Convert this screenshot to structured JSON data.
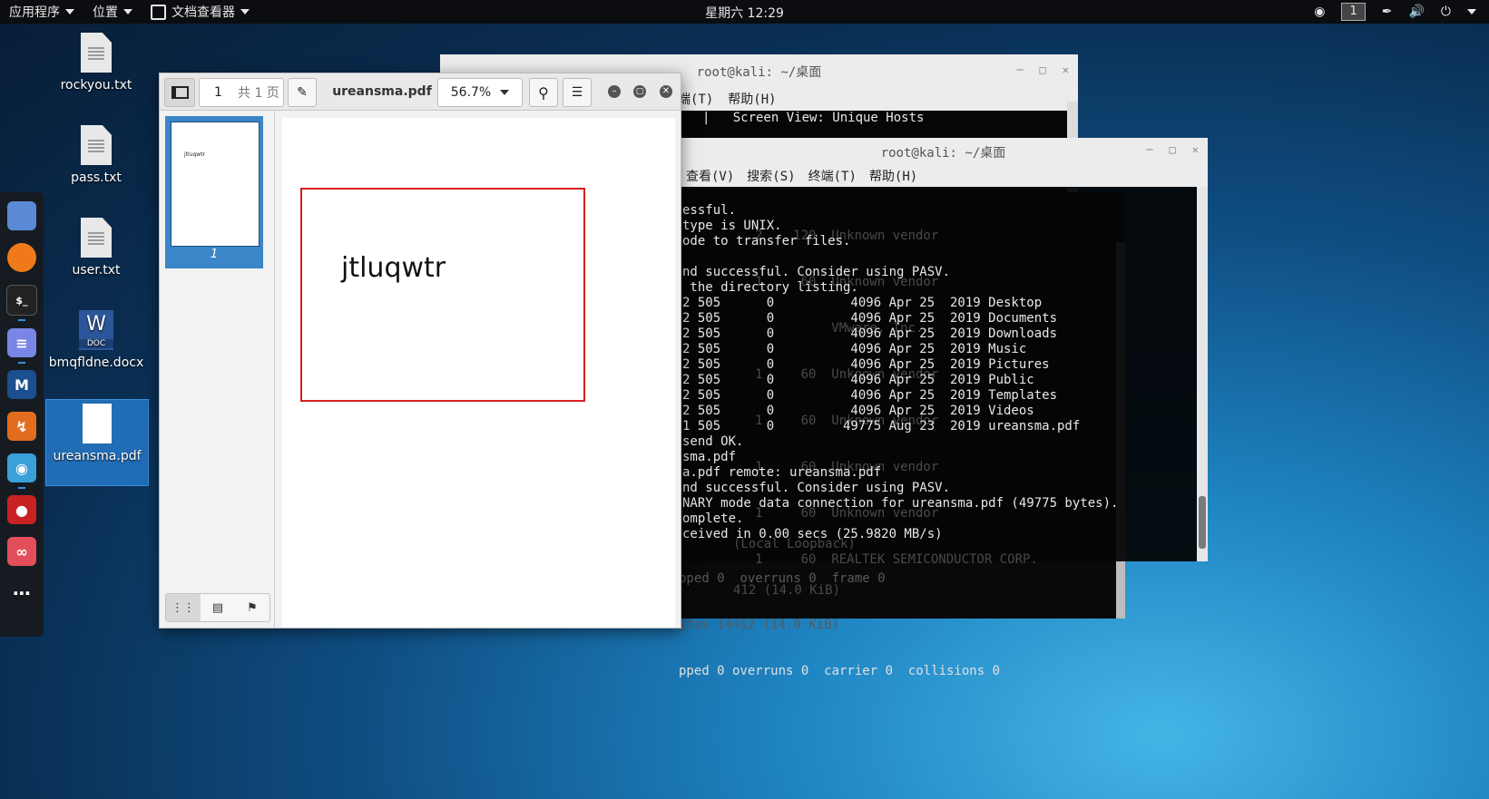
{
  "topbar": {
    "apps_menu": "应用程序",
    "places_menu": "位置",
    "app_name": "文档查看器",
    "clock": "星期六 12:29",
    "workspace": "1"
  },
  "desktop": {
    "icons": [
      {
        "label": "rockyou.txt"
      },
      {
        "label": "pass.txt"
      },
      {
        "label": "user.txt"
      },
      {
        "label": "bmqfldne.docx",
        "badge_letter": "W",
        "badge_text": "DOC"
      },
      {
        "label": "ureansma.pdf"
      }
    ]
  },
  "terminal_back": {
    "title": "root@kali: ~/桌面",
    "menu": [
      "端(T)",
      "帮助(H)"
    ],
    "line": "|   Screen View: Unique Hosts"
  },
  "terminal_front": {
    "title": "root@kali: ~/桌面",
    "menu": [
      "查看(V)",
      "搜索(S)",
      "终端(T)",
      "帮助(H)"
    ],
    "lines": [
      "essful.",
      "type is UNIX.",
      "ode to transfer files.",
      "",
      "nd successful. Consider using PASV.",
      " the directory listing.",
      "2 505      0          4096 Apr 25  2019 Desktop",
      "2 505      0          4096 Apr 25  2019 Documents",
      "2 505      0          4096 Apr 25  2019 Downloads",
      "2 505      0          4096 Apr 25  2019 Music",
      "2 505      0          4096 Apr 25  2019 Pictures",
      "2 505      0          4096 Apr 25  2019 Public",
      "2 505      0          4096 Apr 25  2019 Templates",
      "2 505      0          4096 Apr 25  2019 Videos",
      "1 505      0         49775 Aug 23  2019 ureansma.pdf",
      "send OK.",
      "sma.pdf",
      "a.pdf remote: ureansma.pdf",
      "nd successful. Consider using PASV.",
      "NARY mode data connection for ureansma.pdf (49775 bytes).",
      "omplete.",
      "ceived in 0.00 secs (25.9820 MB/s)"
    ]
  },
  "terminal_ghost": {
    "lines_right": [
      "2    120  Unknown vendor",
      "1     60  Unknown vendor",
      "          VMware, Inc.",
      "1     60  Unknown vendor",
      "1     60  Unknown vendor",
      "1     60  Unknown vendor",
      "1     60  Unknown vendor",
      "1     60  REALTEK SEMICONDUCTOR CORP."
    ],
    "bottom_lines": [
      "pped 0  overruns 0  frame 0",
      "ytes 14412 (14.0 KiB)",
      "pped 0 overruns 0  carrier 0  collisions 0"
    ],
    "mid_lines": [
      "(Local Loopback)",
      "412 (14.0 KiB)"
    ]
  },
  "pdf_viewer": {
    "page_input": "1",
    "page_total": "共 1 页",
    "filename": "ureansma.pdf",
    "zoom": "56.7%",
    "thumbnail_page_number": "1",
    "thumbnail_text": "jtluqwtr",
    "page_text": "jtluqwtr"
  }
}
